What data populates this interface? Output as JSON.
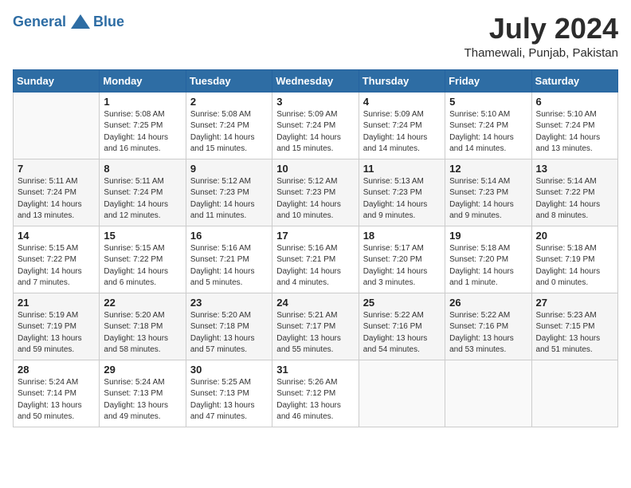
{
  "header": {
    "logo_general": "General",
    "logo_blue": "Blue",
    "month_year": "July 2024",
    "location": "Thamewali, Punjab, Pakistan"
  },
  "weekdays": [
    "Sunday",
    "Monday",
    "Tuesday",
    "Wednesday",
    "Thursday",
    "Friday",
    "Saturday"
  ],
  "weeks": [
    [
      {
        "day": "",
        "info": ""
      },
      {
        "day": "1",
        "info": "Sunrise: 5:08 AM\nSunset: 7:25 PM\nDaylight: 14 hours\nand 16 minutes."
      },
      {
        "day": "2",
        "info": "Sunrise: 5:08 AM\nSunset: 7:24 PM\nDaylight: 14 hours\nand 15 minutes."
      },
      {
        "day": "3",
        "info": "Sunrise: 5:09 AM\nSunset: 7:24 PM\nDaylight: 14 hours\nand 15 minutes."
      },
      {
        "day": "4",
        "info": "Sunrise: 5:09 AM\nSunset: 7:24 PM\nDaylight: 14 hours\nand 14 minutes."
      },
      {
        "day": "5",
        "info": "Sunrise: 5:10 AM\nSunset: 7:24 PM\nDaylight: 14 hours\nand 14 minutes."
      },
      {
        "day": "6",
        "info": "Sunrise: 5:10 AM\nSunset: 7:24 PM\nDaylight: 14 hours\nand 13 minutes."
      }
    ],
    [
      {
        "day": "7",
        "info": "Sunrise: 5:11 AM\nSunset: 7:24 PM\nDaylight: 14 hours\nand 13 minutes."
      },
      {
        "day": "8",
        "info": "Sunrise: 5:11 AM\nSunset: 7:24 PM\nDaylight: 14 hours\nand 12 minutes."
      },
      {
        "day": "9",
        "info": "Sunrise: 5:12 AM\nSunset: 7:23 PM\nDaylight: 14 hours\nand 11 minutes."
      },
      {
        "day": "10",
        "info": "Sunrise: 5:12 AM\nSunset: 7:23 PM\nDaylight: 14 hours\nand 10 minutes."
      },
      {
        "day": "11",
        "info": "Sunrise: 5:13 AM\nSunset: 7:23 PM\nDaylight: 14 hours\nand 9 minutes."
      },
      {
        "day": "12",
        "info": "Sunrise: 5:14 AM\nSunset: 7:23 PM\nDaylight: 14 hours\nand 9 minutes."
      },
      {
        "day": "13",
        "info": "Sunrise: 5:14 AM\nSunset: 7:22 PM\nDaylight: 14 hours\nand 8 minutes."
      }
    ],
    [
      {
        "day": "14",
        "info": "Sunrise: 5:15 AM\nSunset: 7:22 PM\nDaylight: 14 hours\nand 7 minutes."
      },
      {
        "day": "15",
        "info": "Sunrise: 5:15 AM\nSunset: 7:22 PM\nDaylight: 14 hours\nand 6 minutes."
      },
      {
        "day": "16",
        "info": "Sunrise: 5:16 AM\nSunset: 7:21 PM\nDaylight: 14 hours\nand 5 minutes."
      },
      {
        "day": "17",
        "info": "Sunrise: 5:16 AM\nSunset: 7:21 PM\nDaylight: 14 hours\nand 4 minutes."
      },
      {
        "day": "18",
        "info": "Sunrise: 5:17 AM\nSunset: 7:20 PM\nDaylight: 14 hours\nand 3 minutes."
      },
      {
        "day": "19",
        "info": "Sunrise: 5:18 AM\nSunset: 7:20 PM\nDaylight: 14 hours\nand 1 minute."
      },
      {
        "day": "20",
        "info": "Sunrise: 5:18 AM\nSunset: 7:19 PM\nDaylight: 14 hours\nand 0 minutes."
      }
    ],
    [
      {
        "day": "21",
        "info": "Sunrise: 5:19 AM\nSunset: 7:19 PM\nDaylight: 13 hours\nand 59 minutes."
      },
      {
        "day": "22",
        "info": "Sunrise: 5:20 AM\nSunset: 7:18 PM\nDaylight: 13 hours\nand 58 minutes."
      },
      {
        "day": "23",
        "info": "Sunrise: 5:20 AM\nSunset: 7:18 PM\nDaylight: 13 hours\nand 57 minutes."
      },
      {
        "day": "24",
        "info": "Sunrise: 5:21 AM\nSunset: 7:17 PM\nDaylight: 13 hours\nand 55 minutes."
      },
      {
        "day": "25",
        "info": "Sunrise: 5:22 AM\nSunset: 7:16 PM\nDaylight: 13 hours\nand 54 minutes."
      },
      {
        "day": "26",
        "info": "Sunrise: 5:22 AM\nSunset: 7:16 PM\nDaylight: 13 hours\nand 53 minutes."
      },
      {
        "day": "27",
        "info": "Sunrise: 5:23 AM\nSunset: 7:15 PM\nDaylight: 13 hours\nand 51 minutes."
      }
    ],
    [
      {
        "day": "28",
        "info": "Sunrise: 5:24 AM\nSunset: 7:14 PM\nDaylight: 13 hours\nand 50 minutes."
      },
      {
        "day": "29",
        "info": "Sunrise: 5:24 AM\nSunset: 7:13 PM\nDaylight: 13 hours\nand 49 minutes."
      },
      {
        "day": "30",
        "info": "Sunrise: 5:25 AM\nSunset: 7:13 PM\nDaylight: 13 hours\nand 47 minutes."
      },
      {
        "day": "31",
        "info": "Sunrise: 5:26 AM\nSunset: 7:12 PM\nDaylight: 13 hours\nand 46 minutes."
      },
      {
        "day": "",
        "info": ""
      },
      {
        "day": "",
        "info": ""
      },
      {
        "day": "",
        "info": ""
      }
    ]
  ]
}
